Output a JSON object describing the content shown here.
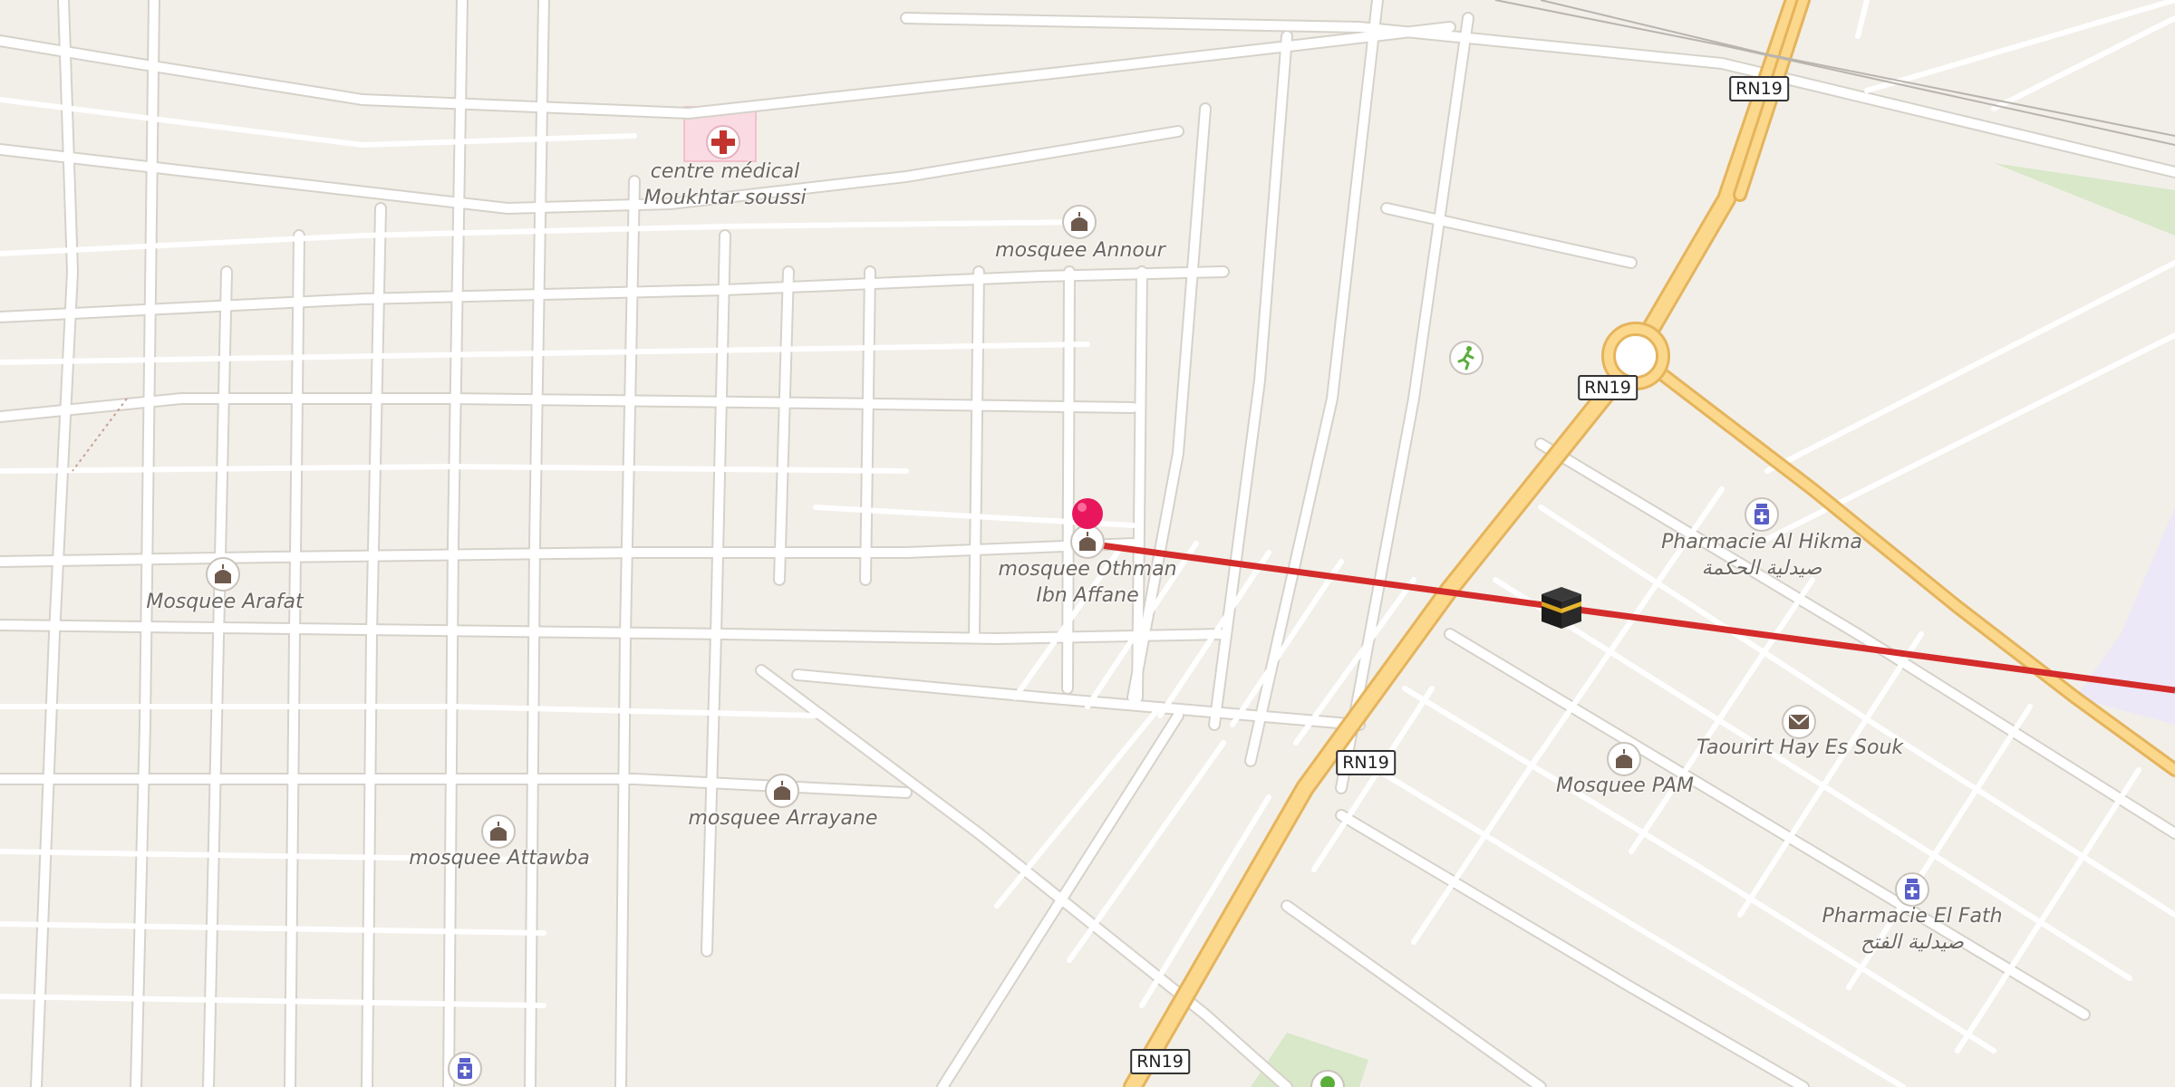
{
  "map": {
    "colors": {
      "land": "#f2efe9",
      "street": "#ffffff",
      "street_casing": "#d6d2ca",
      "trunk_road": "#fbd88c",
      "trunk_casing": "#e5b45c",
      "medical_area": "#fadbe3",
      "park": "#d8e8c8",
      "route_line": "#d42b2b",
      "pin": "#e8175d",
      "poi_icon": "#6e5a4d",
      "pharmacy_icon": "#5a5fc8",
      "sport_icon": "#5cae3a"
    },
    "road_shields": [
      "RN19",
      "RN19",
      "RN19",
      "RN19"
    ],
    "pois": [
      {
        "id": "medical",
        "icon": "medical-cross-icon",
        "lines": [
          "centre médical",
          "Moukhtar soussi"
        ]
      },
      {
        "id": "annour",
        "icon": "mosque-icon",
        "lines": [
          "mosquee Annour"
        ]
      },
      {
        "id": "othman",
        "icon": "mosque-icon",
        "lines": [
          "mosquee Othman",
          "Ibn Affane"
        ]
      },
      {
        "id": "arafat",
        "icon": "mosque-icon",
        "lines": [
          "Mosquee Arafat"
        ]
      },
      {
        "id": "arrayane",
        "icon": "mosque-icon",
        "lines": [
          "mosquee Arrayane"
        ]
      },
      {
        "id": "attawba",
        "icon": "mosque-icon",
        "lines": [
          "mosquee Attawba"
        ]
      },
      {
        "id": "pam",
        "icon": "mosque-icon",
        "lines": [
          "Mosquee PAM"
        ]
      },
      {
        "id": "alhikma",
        "icon": "pharmacy-icon",
        "lines": [
          "Pharmacie Al Hikma",
          "صيدلية الحكمة"
        ]
      },
      {
        "id": "elfath",
        "icon": "pharmacy-icon",
        "lines": [
          "Pharmacie El Fath",
          "صيدلية الفتح"
        ]
      },
      {
        "id": "taourirt",
        "icon": "post-office-icon",
        "lines": [
          "Taourirt Hay Es Souk"
        ]
      }
    ],
    "markers": {
      "pin": "location-pin-icon",
      "kaaba": "kaaba-icon",
      "sport": "sport-running-icon",
      "bottom_pharmacy": "pharmacy-icon",
      "bottom_park": "park-icon"
    }
  }
}
